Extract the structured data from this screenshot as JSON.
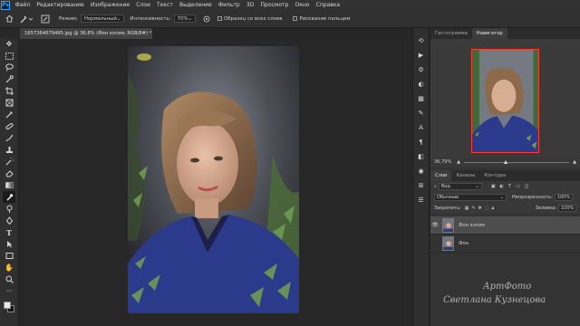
{
  "app": {
    "logo": "Ps",
    "menu": [
      "Файл",
      "Редактирование",
      "Изображение",
      "Слои",
      "Текст",
      "Выделение",
      "Фильтр",
      "3D",
      "Просмотр",
      "Окно",
      "Справка"
    ]
  },
  "options_bar": {
    "mode_label": "Режим:",
    "mode_value": "Нормальный",
    "intensity_label": "Интенсивность:",
    "intensity_value": "70%",
    "sample_all_layers": "Образец со всех слоев",
    "finger_painting": "Рисование пальцем"
  },
  "document_tab": {
    "title": "1657364679495.jpg @ 36,8% (Фон копия, RGB/8#) *",
    "close": "×"
  },
  "panels": {
    "top_tabs": [
      "Гистограмма",
      "Навигатор"
    ],
    "zoom_value": "36,79%",
    "layers_tabs": [
      "Слои",
      "Каналы",
      "Контуры"
    ],
    "filter_value": "Вид",
    "blend_mode": "Обычные",
    "opacity_label": "Непрозрачность:",
    "opacity_value": "100%",
    "lock_label": "Закрепить:",
    "fill_label": "Заливка:",
    "fill_value": "100%",
    "layers": [
      {
        "name": "Фон копия",
        "visible": true,
        "selected": true
      },
      {
        "name": "Фон",
        "visible": false,
        "selected": false
      }
    ]
  },
  "watermark": {
    "line1": "АртФото",
    "line2": "Светлана Кузнецова"
  },
  "colors": {
    "accent_nav_frame": "#ff3b30",
    "brand": "#31a8ff"
  }
}
